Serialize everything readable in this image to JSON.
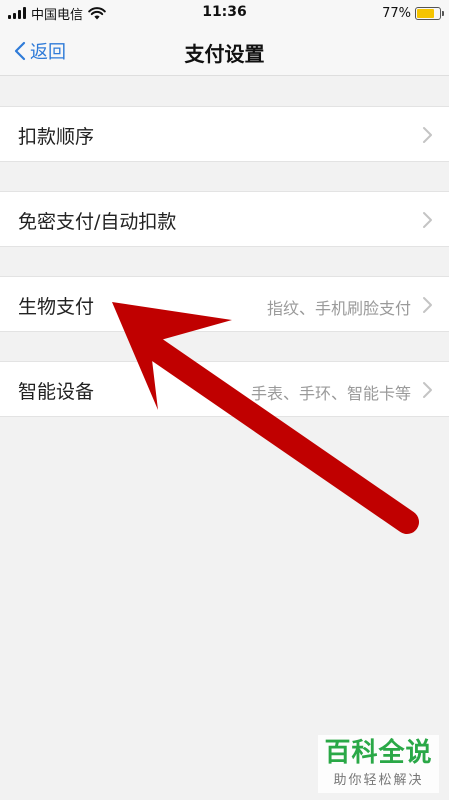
{
  "status_bar": {
    "carrier": "中国电信",
    "time": "11:36",
    "battery_text": "77%",
    "battery_level": 0.77,
    "battery_color": "#f5c400"
  },
  "nav": {
    "back_label": "返回",
    "title": "支付设置",
    "accent_color": "#2f7bd8"
  },
  "rows": [
    {
      "label": "扣款顺序",
      "detail": ""
    },
    {
      "label": "免密支付/自动扣款",
      "detail": ""
    },
    {
      "label": "生物支付",
      "detail": "指纹、手机刷脸支付"
    },
    {
      "label": "智能设备",
      "detail": "手表、手环、智能卡等"
    }
  ],
  "annotation": {
    "arrow_color": "#c00000"
  },
  "watermark": {
    "title": "百科全说",
    "subtitle": "助你轻松解决"
  }
}
